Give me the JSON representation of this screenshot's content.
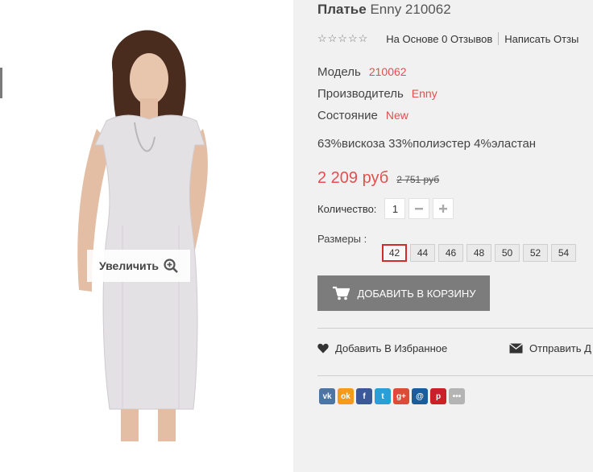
{
  "product": {
    "title_bold": "Платье",
    "title_rest": "Enny 210062",
    "rating_stars": "☆☆☆☆☆",
    "reviews_link": "На Основе 0 Отзывов",
    "write_review_link": "Написать Отзы",
    "model_label": "Модель",
    "model_value": "210062",
    "maker_label": "Производитель",
    "maker_value": "Enny",
    "condition_label": "Состояние",
    "condition_value": "New",
    "composition": "63%вискоза 33%полиэстер 4%эластан",
    "price": "2 209 руб",
    "old_price": "2 751 руб",
    "quantity_label": "Количество:",
    "quantity_value": "1",
    "sizes_label": "Размеры :",
    "sizes": [
      "42",
      "44",
      "46",
      "48",
      "50",
      "52",
      "54"
    ],
    "selected_size": "42",
    "add_to_cart": "ДОБАВИТЬ В КОРЗИНУ",
    "wishlist": "Добавить В Избранное",
    "send": "Отправить Д"
  },
  "gallery": {
    "zoom_label": "Увеличить"
  },
  "colors": {
    "accent": "#e0504f",
    "button": "#7c7c7c",
    "selected_border": "#d12b2b"
  },
  "social": [
    {
      "icon": "vk-icon",
      "glyph": "vk",
      "color": "#4c75a3"
    },
    {
      "icon": "odnoklassniki-icon",
      "glyph": "ok",
      "color": "#f59a1b"
    },
    {
      "icon": "facebook-icon",
      "glyph": "f",
      "color": "#3b5998"
    },
    {
      "icon": "twitter-icon",
      "glyph": "t",
      "color": "#2a9fd6"
    },
    {
      "icon": "google-plus-icon",
      "glyph": "g+",
      "color": "#dd4b39"
    },
    {
      "icon": "mailru-icon",
      "glyph": "@",
      "color": "#1a5d9c"
    },
    {
      "icon": "pinterest-icon",
      "glyph": "p",
      "color": "#cb2027"
    },
    {
      "icon": "more-icon",
      "glyph": "•••",
      "color": "#b4b4b4"
    }
  ]
}
